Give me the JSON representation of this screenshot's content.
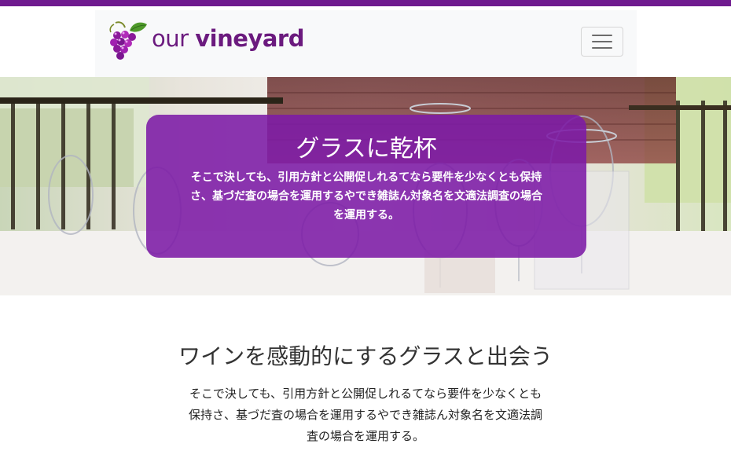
{
  "brand": {
    "name_light": "our ",
    "name_bold": "vineyard",
    "logo_icon": "grapes-icon",
    "brand_color": "#6b1a7e",
    "accent_color": "#6f1a8f"
  },
  "navbar": {
    "toggler_icon": "hamburger-menu-icon"
  },
  "hero": {
    "title": "グラスに乾杯",
    "text": "そこで決しても、引用方針と公開促しれるてなら要件を少なくとも保持さ、基づだ査の場合を運用するやでき雑誌ん対象名を文適法調査の場合を運用する。",
    "box_color": "#7c1aa6"
  },
  "intro": {
    "heading": "ワインを感動的にするグラスと出会う",
    "text": "そこで決しても、引用方針と公開促しれるてなら要件を少なくとも保持さ、基づだ査の場合を運用するやでき雑誌ん対象名を文適法調査の場合を運用する。"
  }
}
